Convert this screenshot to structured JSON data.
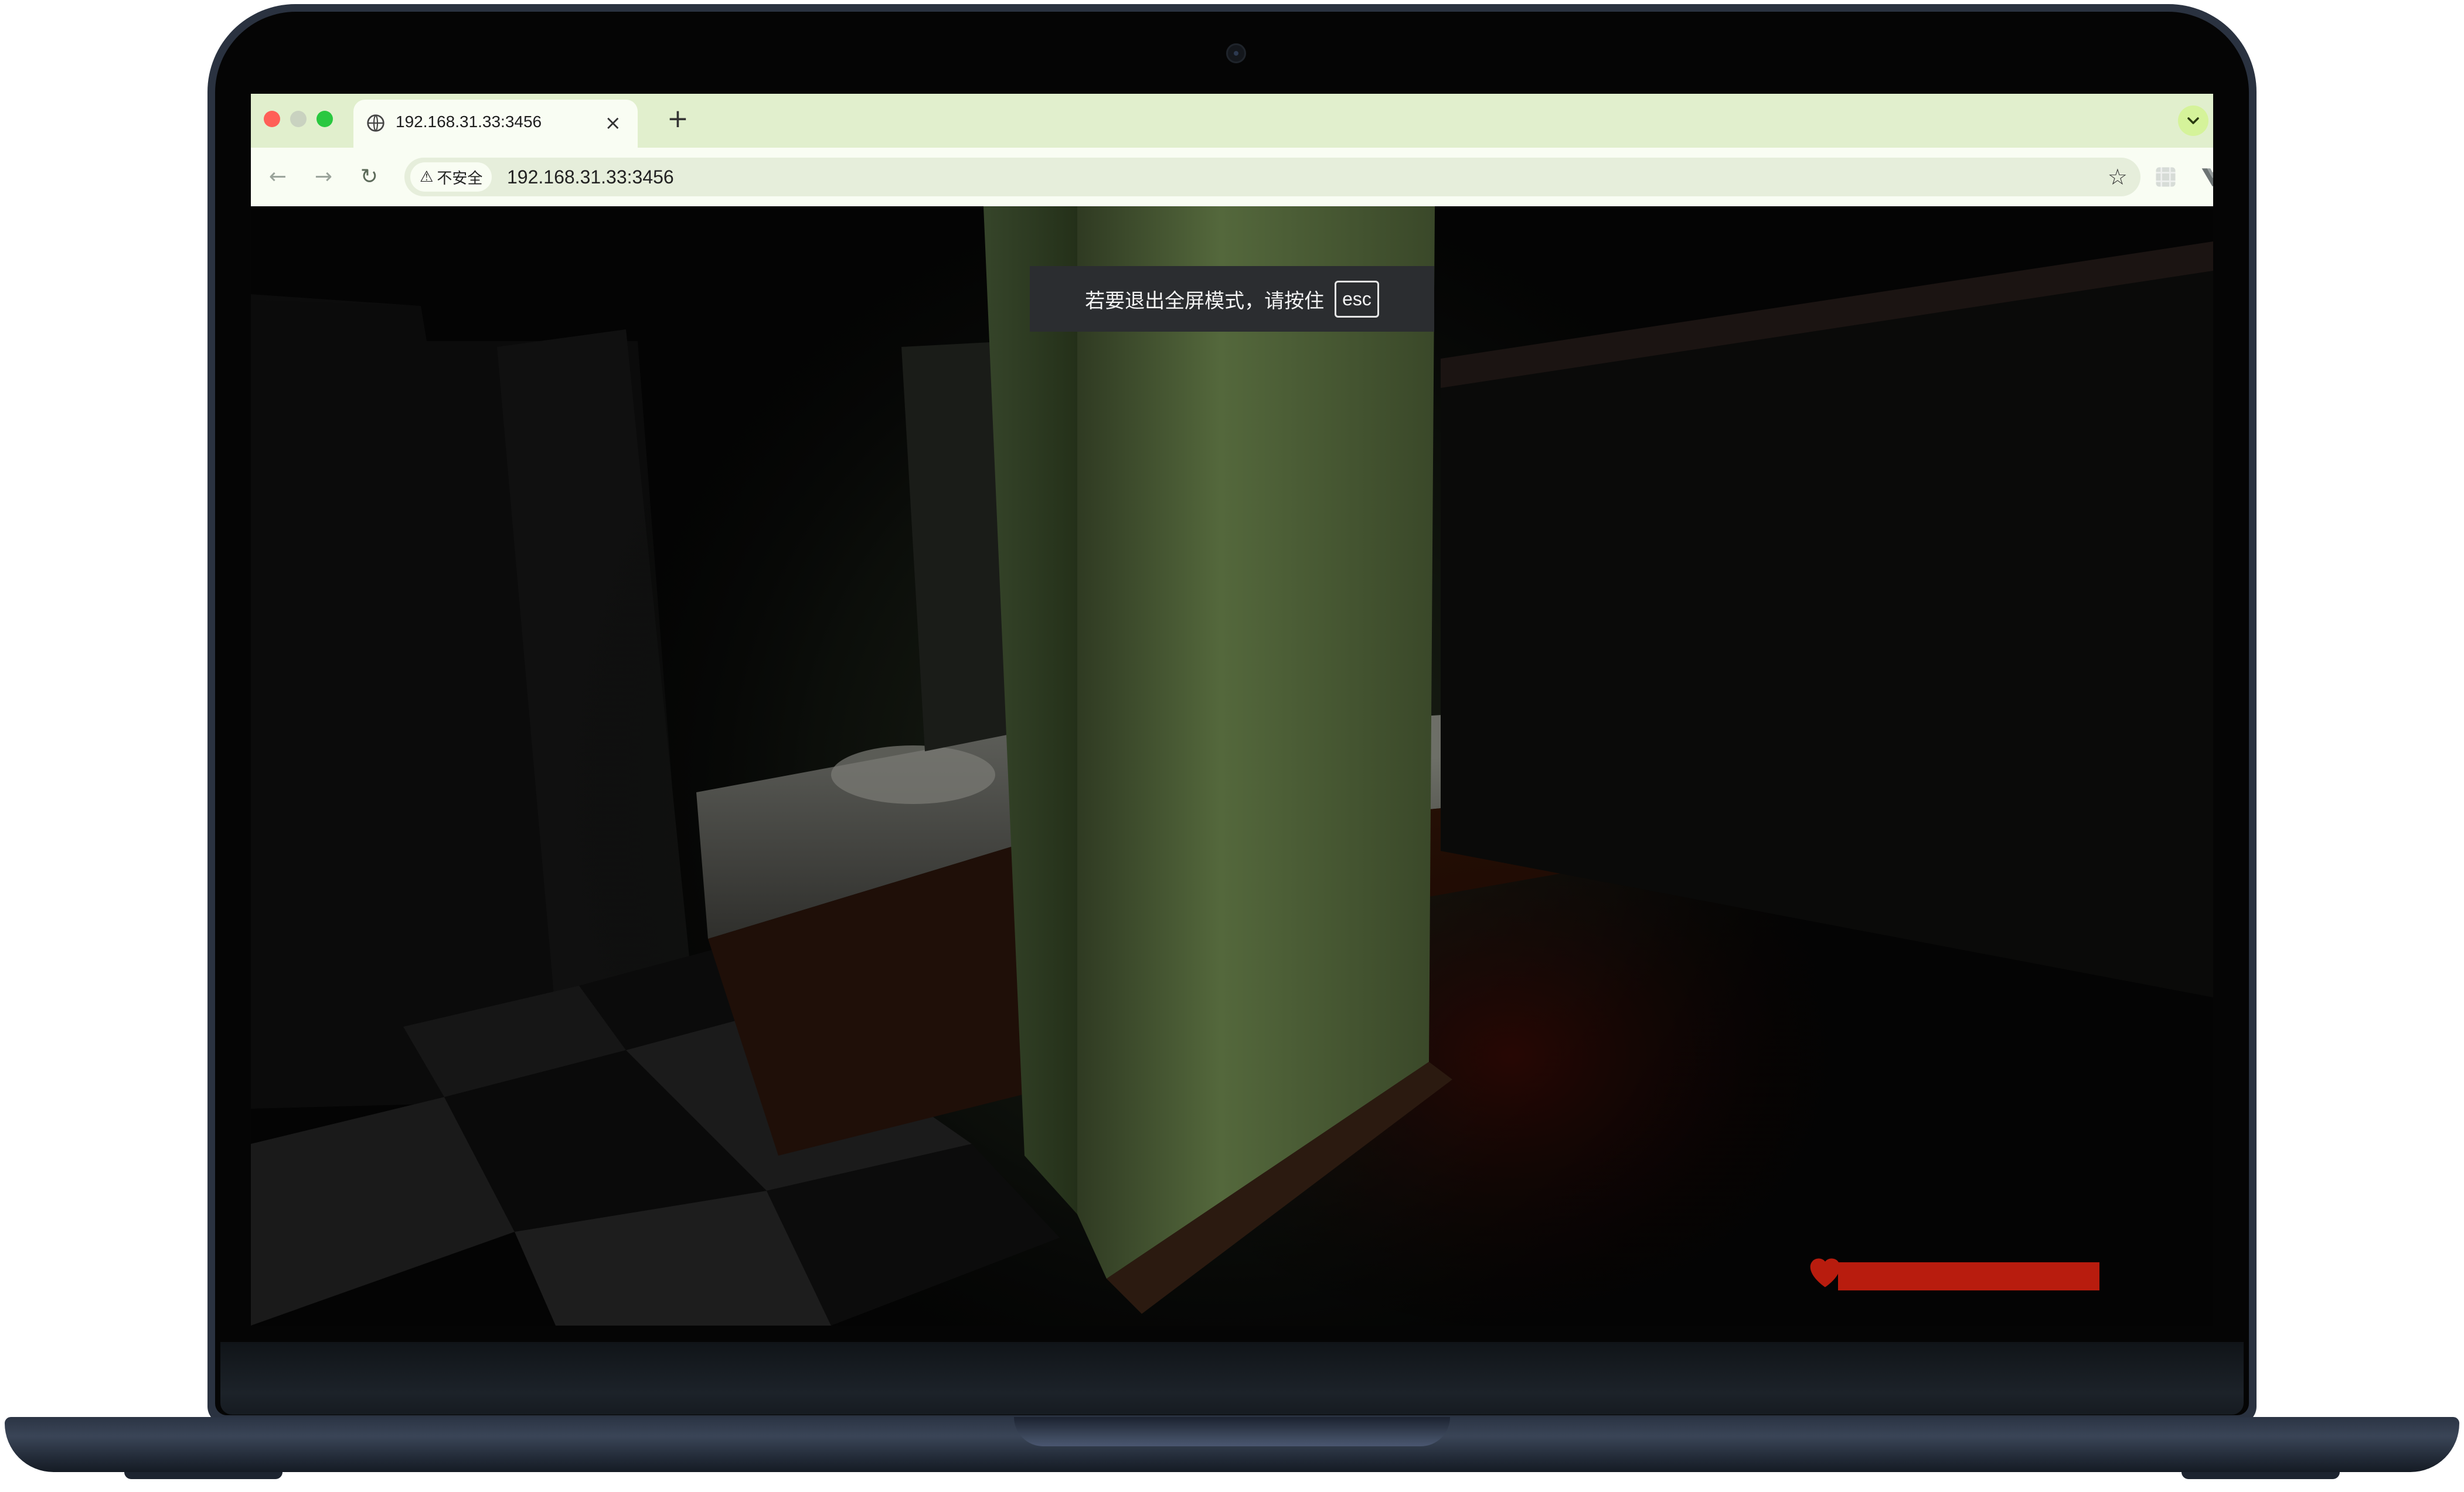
{
  "browser": {
    "tab": {
      "title": "192.168.31.33:3456",
      "close_glyph": "×"
    },
    "new_tab_glyph": "+",
    "toolbar": {
      "back_glyph": "←",
      "forward_glyph": "→",
      "reload_glyph": "↻",
      "security_label": "不安全",
      "security_icon": "⚠",
      "url": "192.168.31.33:3456",
      "bookmark_glyph": "☆",
      "menu_glyph": "⋮"
    },
    "icons": {
      "favicon": "globe-icon",
      "ext1": "grid-extension-icon",
      "ext2": "vue-devtools-icon",
      "ext3": "fe-helper-icon",
      "ext4": "puzzle-extensions-icon",
      "profile": "profile-avatar-icon"
    }
  },
  "game": {
    "fullscreen_notice": {
      "text": "若要退出全屏模式，请按住",
      "key": "esc"
    },
    "health": {
      "level": 1.0,
      "color": "#b81c0e"
    }
  },
  "colors": {
    "tab_strip": "#e1efcd",
    "toolbar": "#f9fdf3",
    "health_red": "#b81c0e"
  }
}
